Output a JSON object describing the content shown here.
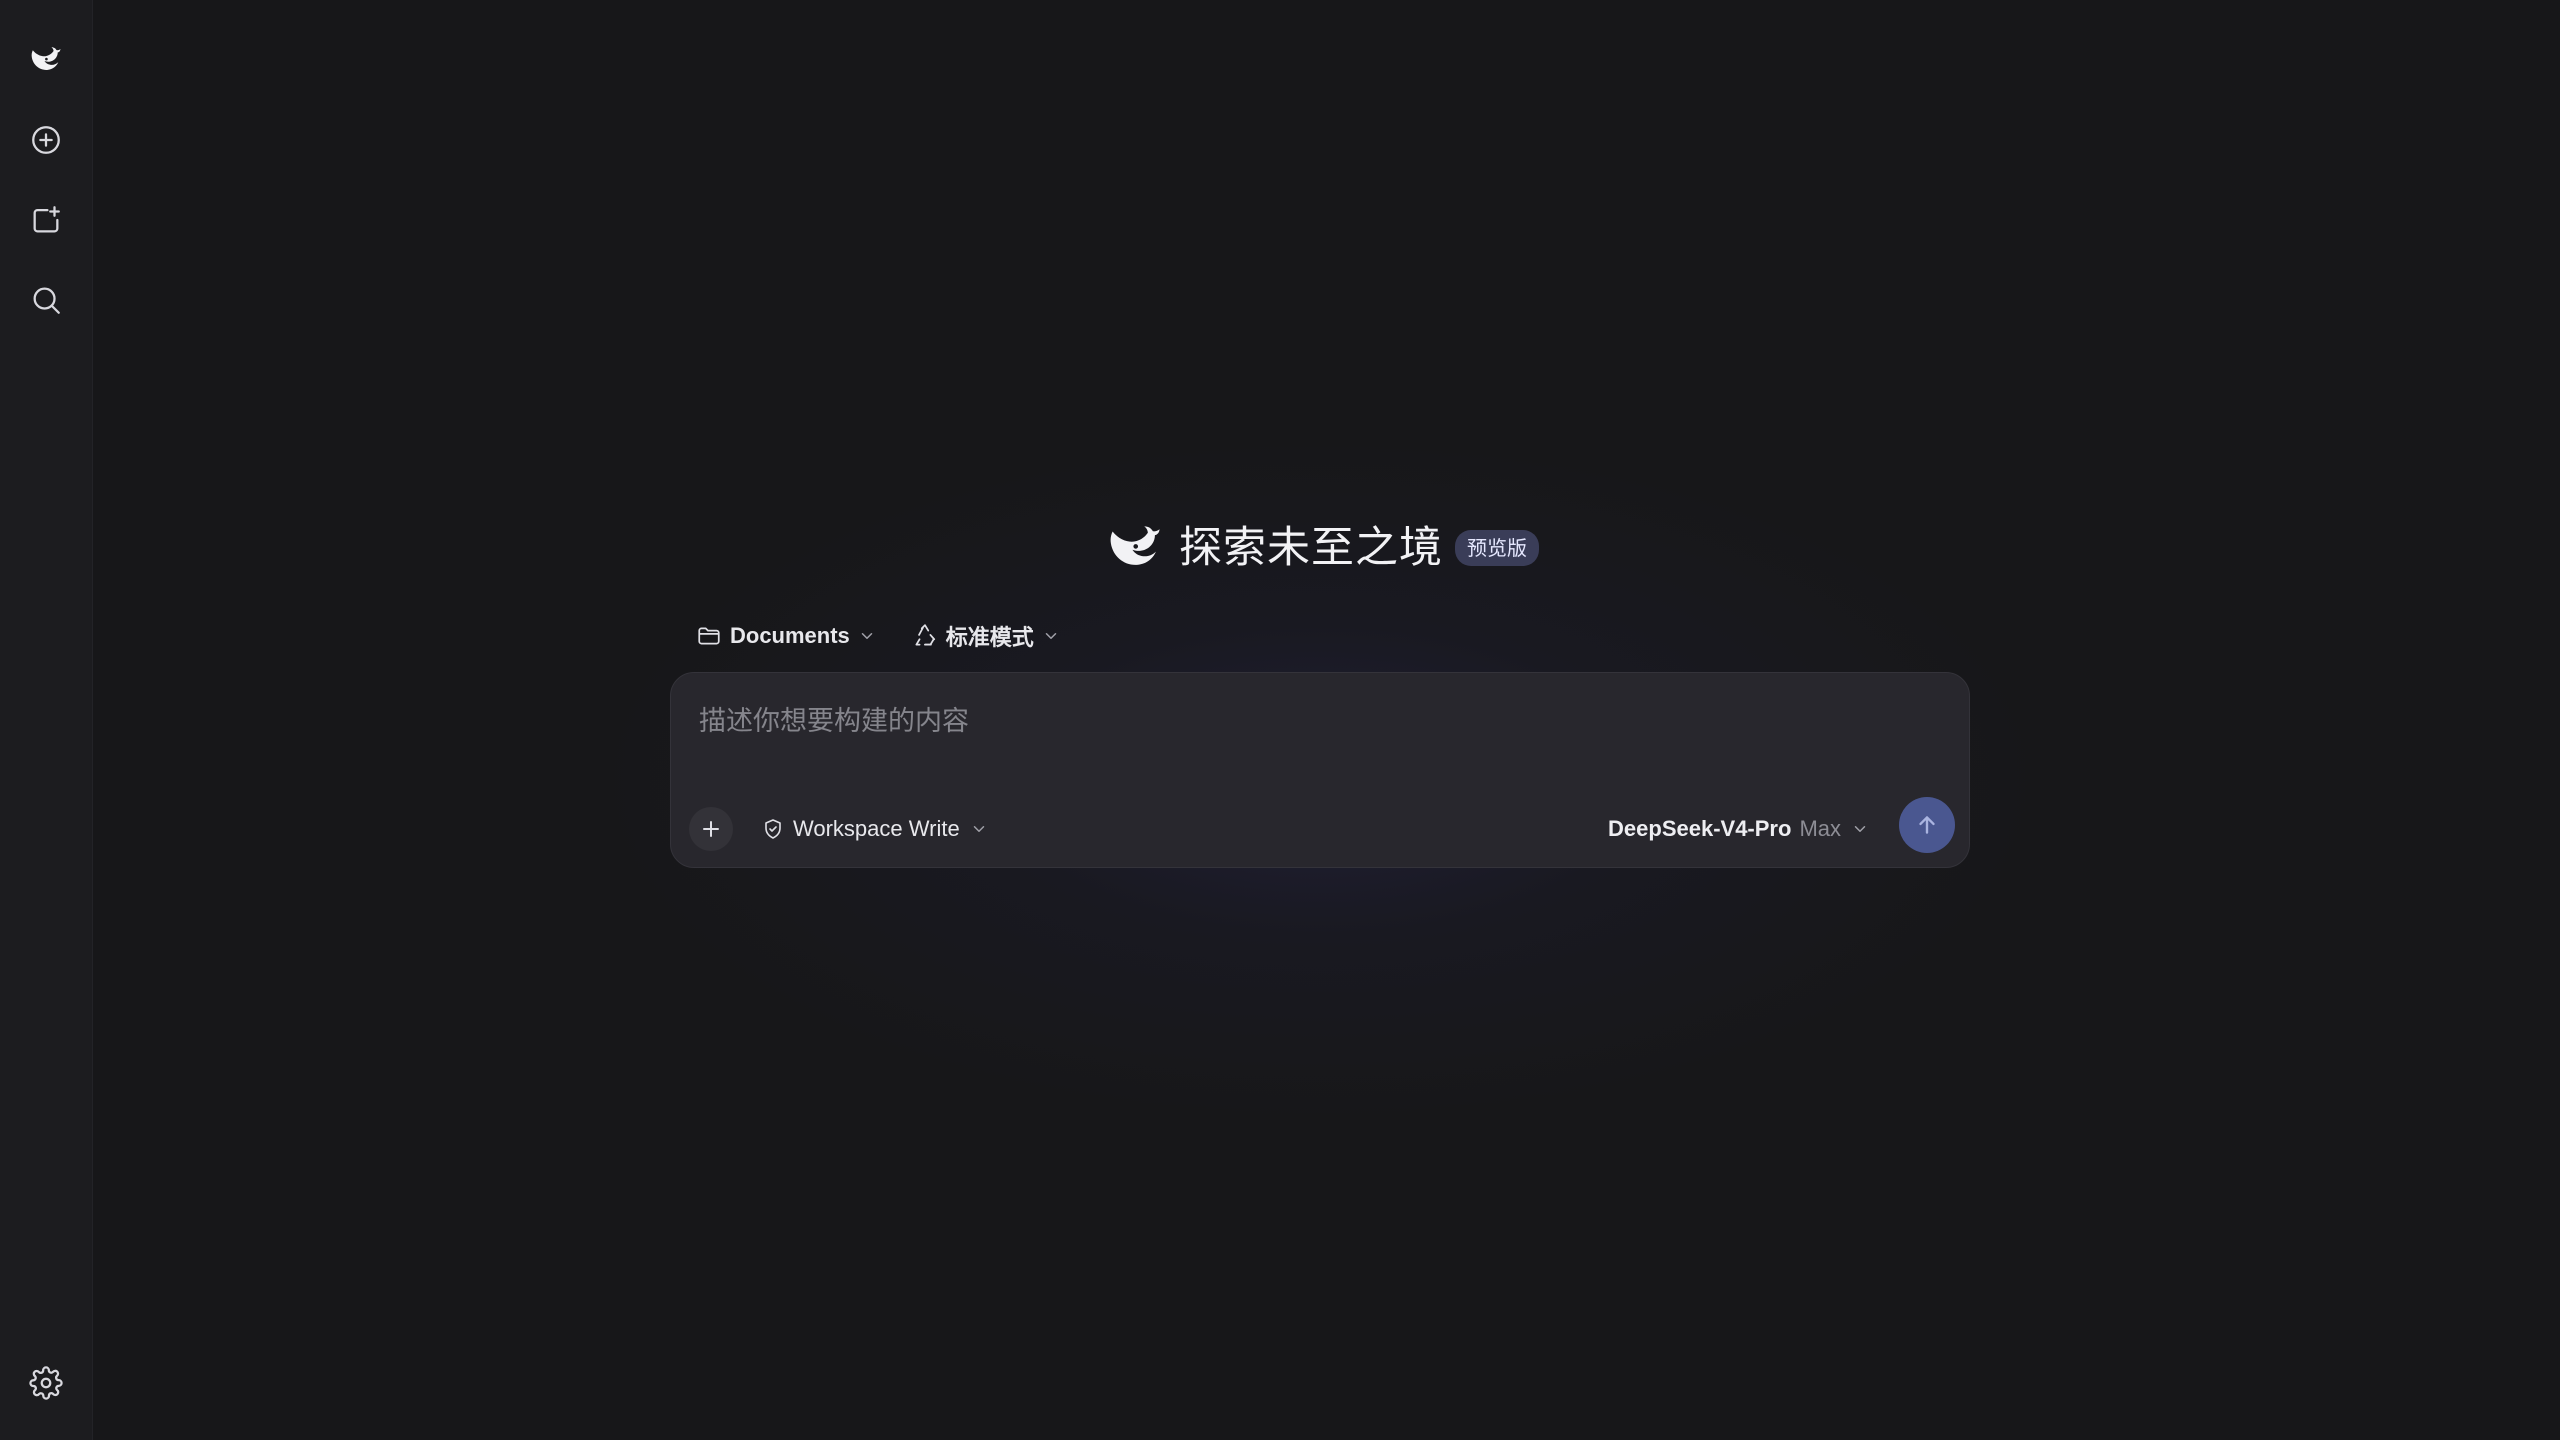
{
  "sidebar": {
    "items": [
      {
        "name": "logo",
        "icon": "whale-logo-icon"
      },
      {
        "name": "new-chat",
        "icon": "plus-circle-icon"
      },
      {
        "name": "new-project",
        "icon": "folder-plus-icon"
      },
      {
        "name": "search",
        "icon": "search-icon"
      }
    ],
    "settings_icon": "gear-icon"
  },
  "hero": {
    "title": "探索未至之境",
    "badge": "预览版",
    "logo_icon": "whale-logo-icon"
  },
  "selectors": {
    "folder": {
      "label": "Documents",
      "icon": "folder-icon"
    },
    "mode": {
      "label": "标准模式",
      "icon": "recycle-icon"
    }
  },
  "composer": {
    "placeholder": "描述你想要构建的内容",
    "value": "",
    "add_icon": "plus-icon",
    "permission": {
      "label": "Workspace Write",
      "icon": "shield-icon"
    },
    "model": {
      "name": "DeepSeek-V4-Pro",
      "level": "Max"
    },
    "send_icon": "arrow-up-icon"
  },
  "colors": {
    "background": "#171719",
    "sidebar": "#1c1c1f",
    "composer": "#28272d",
    "send_button": "#4a5790",
    "badge": "#3a3d58"
  }
}
